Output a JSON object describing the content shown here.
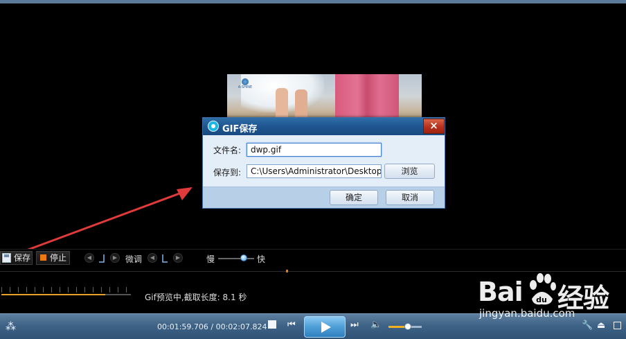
{
  "dialog": {
    "title": "GIF保存",
    "close_label": "×",
    "filename_label": "文件名:",
    "filename_value": "dwp.gif",
    "saveto_label": "保存到:",
    "saveto_value": "C:\\Users\\Administrator\\Desktop",
    "browse_label": "浏览",
    "ok_label": "确定",
    "cancel_label": "取消"
  },
  "controls": {
    "save_label": "保存",
    "stop_label": "停止",
    "finetune_label": "微调",
    "slow_label": "慢",
    "fast_label": "快"
  },
  "status": {
    "text": "Gif预览中,截取长度: 8.1 秒",
    "progress_fraction": 0.8
  },
  "player": {
    "time": "00:01:59.706 / 00:02:07.824",
    "volume_fraction": 0.6
  },
  "watermark": {
    "brand_left": "Bai",
    "brand_right": "经验",
    "url": "jingyan.baidu.com"
  },
  "video": {
    "logo_text": "A-SHINE"
  },
  "colors": {
    "accent_orange": "#f07a10",
    "annotation_arrow": "#e03a3a",
    "dialog_title": "#1f5590"
  }
}
